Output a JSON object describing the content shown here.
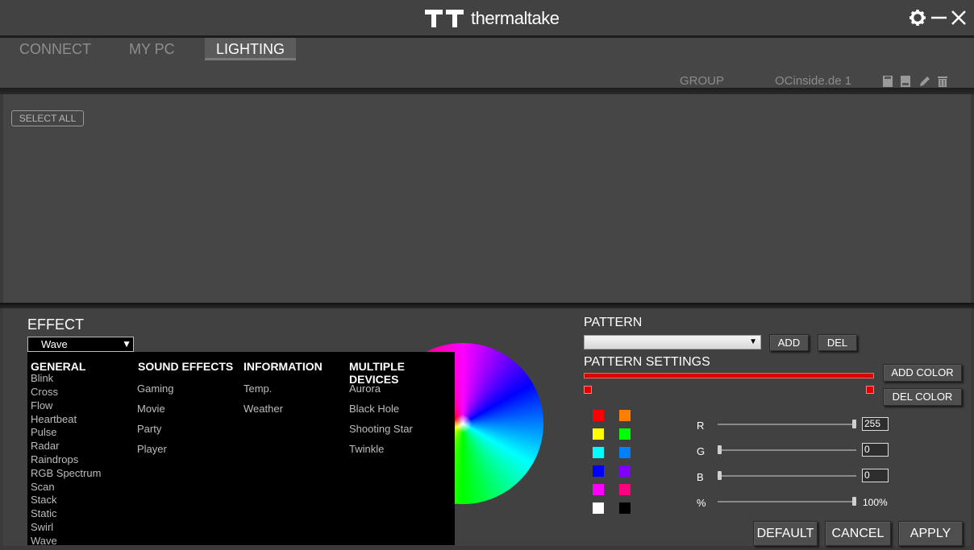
{
  "brand": {
    "name": "thermaltake"
  },
  "window_controls": {
    "settings": "gear-icon",
    "minimize": "minimize-icon",
    "close": "close-icon"
  },
  "tabs": [
    {
      "label": "CONNECT",
      "active": false
    },
    {
      "label": "MY PC",
      "active": false
    },
    {
      "label": "LIGHTING",
      "active": true
    }
  ],
  "group": {
    "label": "GROUP",
    "name": "OCinside.de 1",
    "icons": [
      "save-icon",
      "load-icon",
      "edit-icon",
      "delete-icon"
    ]
  },
  "devices": {
    "select_all": "SELECT ALL"
  },
  "effect": {
    "label": "EFFECT",
    "selected": "Wave",
    "menu": {
      "general": {
        "header": "GENERAL",
        "items": [
          "Blink",
          "Cross",
          "Flow",
          "Heartbeat",
          "Pulse",
          "Radar",
          "Raindrops",
          "RGB Spectrum",
          "Scan",
          "Stack",
          "Static",
          "Swirl",
          "Wave"
        ]
      },
      "sound_effects": {
        "header": "SOUND EFFECTS",
        "items": [
          "Gaming",
          "Movie",
          "Party",
          "Player"
        ]
      },
      "information": {
        "header": "INFORMATION",
        "items": [
          "Temp.",
          "Weather"
        ]
      },
      "multiple_devices": {
        "header": "MULTIPLE DEVICES",
        "items": [
          "Aurora",
          "Black Hole",
          "Shooting Star",
          "Twinkle"
        ]
      }
    }
  },
  "pattern": {
    "label": "PATTERN",
    "selected": "",
    "add": "ADD",
    "del": "DEL"
  },
  "pattern_settings": {
    "label": "PATTERN SETTINGS",
    "bar_color": "#e00000",
    "add_color": "ADD COLOR",
    "del_color": "DEL COLOR"
  },
  "swatches": [
    "#ff0000",
    "#ff8000",
    "#ffff00",
    "#00ff00",
    "#00ffff",
    "#0080ff",
    "#0000ff",
    "#8000ff",
    "#ff00ff",
    "#ff0080",
    "#ffffff",
    "#000000"
  ],
  "rgb": {
    "r": {
      "label": "R",
      "value": "255",
      "level": 1.0
    },
    "g": {
      "label": "G",
      "value": "0",
      "level": 0.0
    },
    "b": {
      "label": "B",
      "value": "0",
      "level": 0.0
    },
    "brightness": {
      "label": "%",
      "value": "100%",
      "level": 1.0
    }
  },
  "footer": {
    "default": "DEFAULT",
    "cancel": "CANCEL",
    "apply": "APPLY"
  }
}
